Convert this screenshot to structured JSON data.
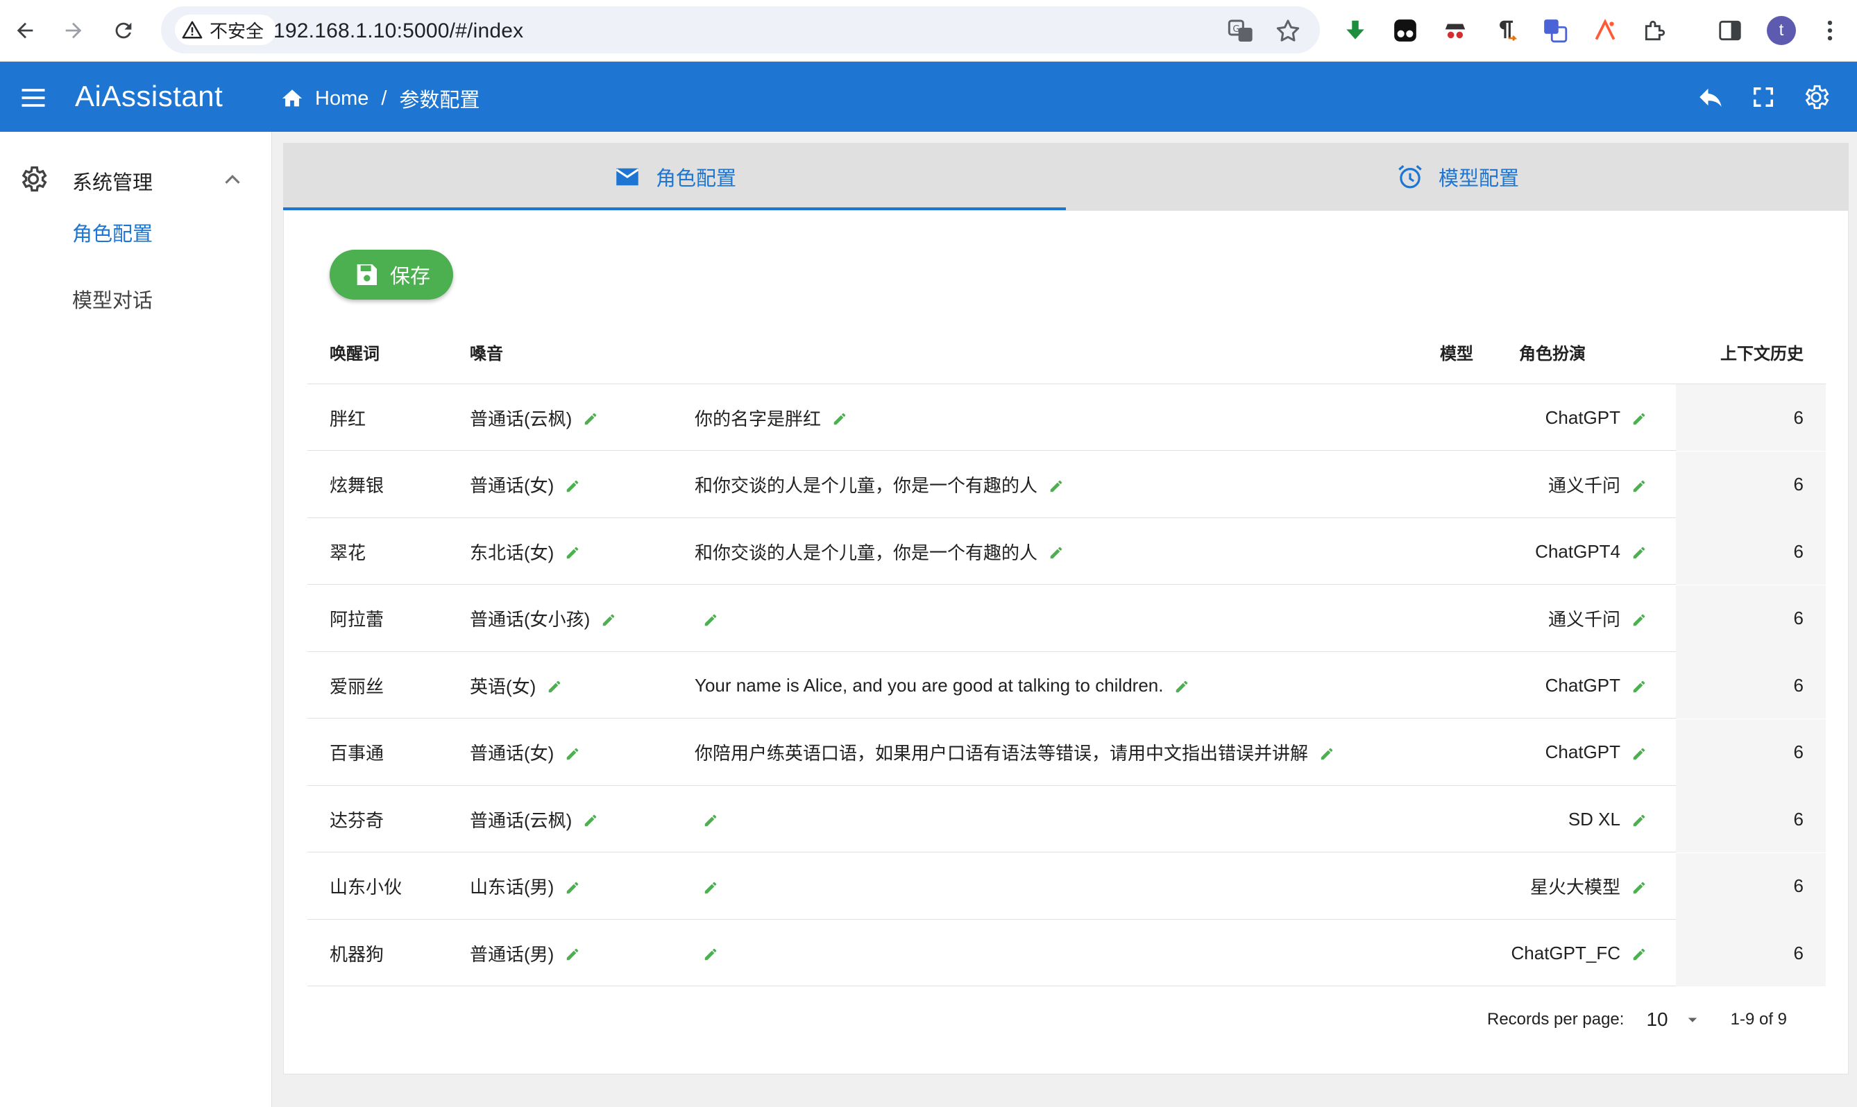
{
  "browser": {
    "security_label": "不安全",
    "url": "192.168.1.10:5000/#/index",
    "profile_initial": "t"
  },
  "app": {
    "title": "AiAssistant",
    "breadcrumb": [
      "Home",
      "参数配置"
    ],
    "accent": "#1e76d2"
  },
  "sidebar": {
    "group_label": "系统管理",
    "items": [
      {
        "label": "角色配置",
        "active": true
      },
      {
        "label": "模型对话",
        "active": false
      }
    ]
  },
  "tabs": [
    {
      "label": "角色配置",
      "icon": "mail-icon",
      "active": true
    },
    {
      "label": "模型配置",
      "icon": "alarm-icon",
      "active": false
    }
  ],
  "toolbar": {
    "save_label": "保存",
    "save_color": "#4caf50"
  },
  "table": {
    "headers": {
      "wake": "唤醒词",
      "voice": "嗓音",
      "model": "模型",
      "role": "角色扮演",
      "history": "上下文历史"
    },
    "rows": [
      {
        "wake": "胖红",
        "voice": "普通话(云枫)",
        "role": "你的名字是胖红",
        "model": "ChatGPT",
        "history": "6"
      },
      {
        "wake": "炫舞银",
        "voice": "普通话(女)",
        "role": "和你交谈的人是个儿童，你是一个有趣的人",
        "model": "通义千问",
        "history": "6"
      },
      {
        "wake": "翠花",
        "voice": "东北话(女)",
        "role": "和你交谈的人是个儿童，你是一个有趣的人",
        "model": "ChatGPT4",
        "history": "6"
      },
      {
        "wake": "阿拉蕾",
        "voice": "普通话(女小孩)",
        "role": "",
        "model": "通义千问",
        "history": "6"
      },
      {
        "wake": "爱丽丝",
        "voice": "英语(女)",
        "role": "Your name is Alice, and you are good at talking to children.",
        "model": "ChatGPT",
        "history": "6"
      },
      {
        "wake": "百事通",
        "voice": "普通话(女)",
        "role": "你陪用户练英语口语，如果用户口语有语法等错误，请用中文指出错误并讲解",
        "model": "ChatGPT",
        "history": "6"
      },
      {
        "wake": "达芬奇",
        "voice": "普通话(云枫)",
        "role": "",
        "model": "SD XL",
        "history": "6"
      },
      {
        "wake": "山东小伙",
        "voice": "山东话(男)",
        "role": "",
        "model": "星火大模型",
        "history": "6"
      },
      {
        "wake": "机器狗",
        "voice": "普通话(男)",
        "role": "",
        "model": "ChatGPT_FC",
        "history": "6"
      }
    ]
  },
  "pagination": {
    "records_per_page_label": "Records per page:",
    "records_per_page": "10",
    "range": "1-9 of 9"
  }
}
